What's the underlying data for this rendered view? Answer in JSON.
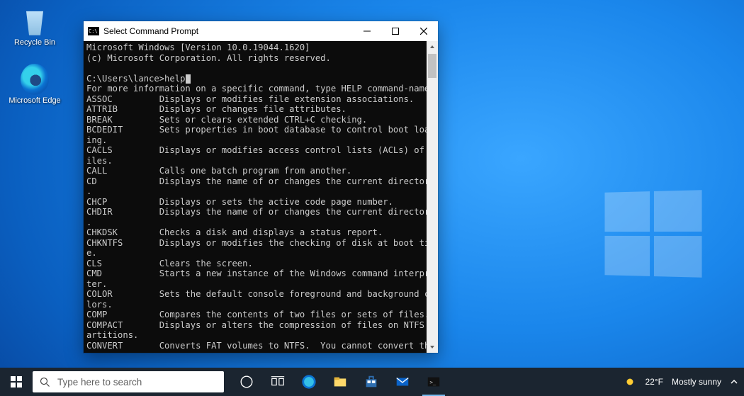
{
  "desktop": {
    "icons": [
      {
        "label": "Recycle Bin"
      },
      {
        "label": "Microsoft Edge"
      }
    ]
  },
  "window": {
    "title": "Select Command Prompt",
    "header_line1": "Microsoft Windows [Version 10.0.19044.1620]",
    "header_line2": "(c) Microsoft Corporation. All rights reserved.",
    "prompt_prefix": "C:\\Users\\lance>",
    "prompt_command": "help",
    "intro": "For more information on a specific command, type HELP command-name",
    "commands": [
      {
        "name": "ASSOC",
        "desc": "Displays or modifies file extension associations."
      },
      {
        "name": "ATTRIB",
        "desc": "Displays or changes file attributes."
      },
      {
        "name": "BREAK",
        "desc": "Sets or clears extended CTRL+C checking."
      },
      {
        "name": "BCDEDIT",
        "desc": "Sets properties in boot database to control boot load",
        "wrap": "ing."
      },
      {
        "name": "CACLS",
        "desc": "Displays or modifies access control lists (ACLs) of f",
        "wrap": "iles."
      },
      {
        "name": "CALL",
        "desc": "Calls one batch program from another."
      },
      {
        "name": "CD",
        "desc": "Displays the name of or changes the current directory",
        "wrap": "."
      },
      {
        "name": "CHCP",
        "desc": "Displays or sets the active code page number."
      },
      {
        "name": "CHDIR",
        "desc": "Displays the name of or changes the current directory",
        "wrap": "."
      },
      {
        "name": "CHKDSK",
        "desc": "Checks a disk and displays a status report."
      },
      {
        "name": "CHKNTFS",
        "desc": "Displays or modifies the checking of disk at boot tim",
        "wrap": "e."
      },
      {
        "name": "CLS",
        "desc": "Clears the screen."
      },
      {
        "name": "CMD",
        "desc": "Starts a new instance of the Windows command interpre",
        "wrap": "ter."
      },
      {
        "name": "COLOR",
        "desc": "Sets the default console foreground and background co",
        "wrap": "lors."
      },
      {
        "name": "COMP",
        "desc": "Compares the contents of two files or sets of files."
      },
      {
        "name": "COMPACT",
        "desc": "Displays or alters the compression of files on NTFS p",
        "wrap": "artitions."
      },
      {
        "name": "CONVERT",
        "desc": "Converts FAT volumes to NTFS.  You cannot convert the"
      }
    ]
  },
  "taskbar": {
    "search_placeholder": "Type here to search",
    "weather_temp": "22°F",
    "weather_desc": "Mostly sunny"
  }
}
